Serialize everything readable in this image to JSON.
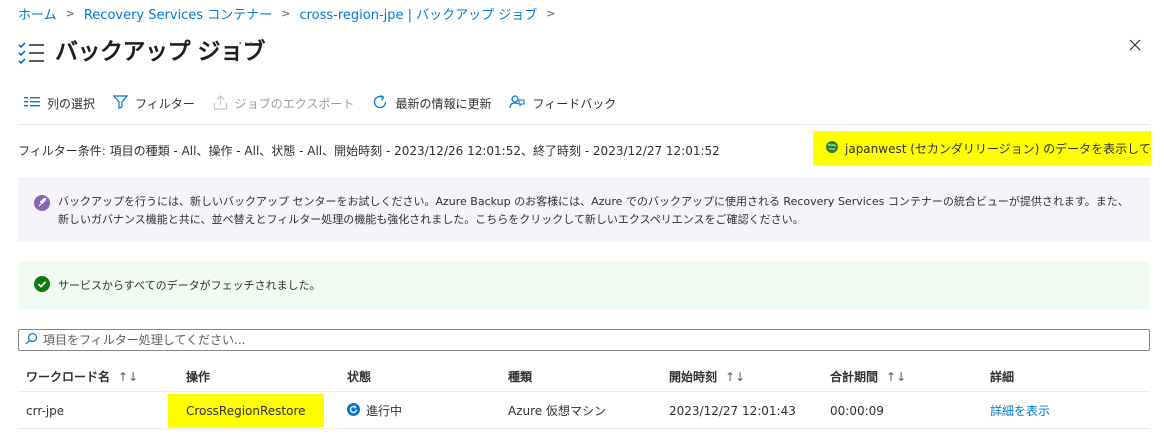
{
  "breadcrumb": {
    "items": [
      "ホーム",
      "Recovery Services コンテナー",
      "cross-region-jpe | バックアップ ジョブ"
    ]
  },
  "title": {
    "text": "バックアップ ジョブ",
    "more": "···"
  },
  "toolbar": {
    "columns": "列の選択",
    "filter": "フィルター",
    "export": "ジョブのエクスポート",
    "refresh": "最新の情報に更新",
    "feedback": "フィードバック"
  },
  "filter_summary": "フィルター条件: 項目の種類 - All、操作 - All、状態 - All、開始時刻 - 2023/12/26 12:01:52、終了時刻 - 2023/12/27 12:01:52",
  "region_notice": "japanwest (セカンダリリージョン) のデータを表示しています",
  "info_banner": "バックアップを行うには、新しいバックアップ センターをお試しください。Azure Backup のお客様には、Azure でのバックアップに使用される Recovery Services コンテナーの統合ビューが提供されます。また、新しいガバナンス機能と共に、並べ替えとフィルター処理の機能も強化されました。こちらをクリックして新しいエクスペリエンスをご確認ください。",
  "success_banner": "サービスからすべてのデータがフェッチされました。",
  "search": {
    "placeholder": "項目をフィルター処理してください..."
  },
  "table": {
    "columns": {
      "workload": "ワークロード名",
      "operation": "操作",
      "status": "状態",
      "type": "種類",
      "start": "開始時刻",
      "duration": "合計期間",
      "details": "詳細"
    },
    "sort_glyph": "↑↓",
    "rows": [
      {
        "workload": "crr-jpe",
        "operation": "CrossRegionRestore",
        "status": "進行中",
        "type": "Azure 仮想マシン",
        "start": "2023/12/27 12:01:43",
        "duration": "00:00:09",
        "details": "詳細を表示"
      }
    ]
  },
  "colors": {
    "accent": "#0078d4",
    "highlight": "#ffff00",
    "success": "#107c10",
    "info_icon": "#8764b8"
  },
  "icons": [
    "title-jobs-icon",
    "close-icon",
    "columns-icon",
    "filter-icon",
    "export-icon",
    "refresh-icon",
    "feedback-icon",
    "globe-icon",
    "rocket-icon",
    "success-check-icon",
    "search-icon",
    "in-progress-icon"
  ]
}
